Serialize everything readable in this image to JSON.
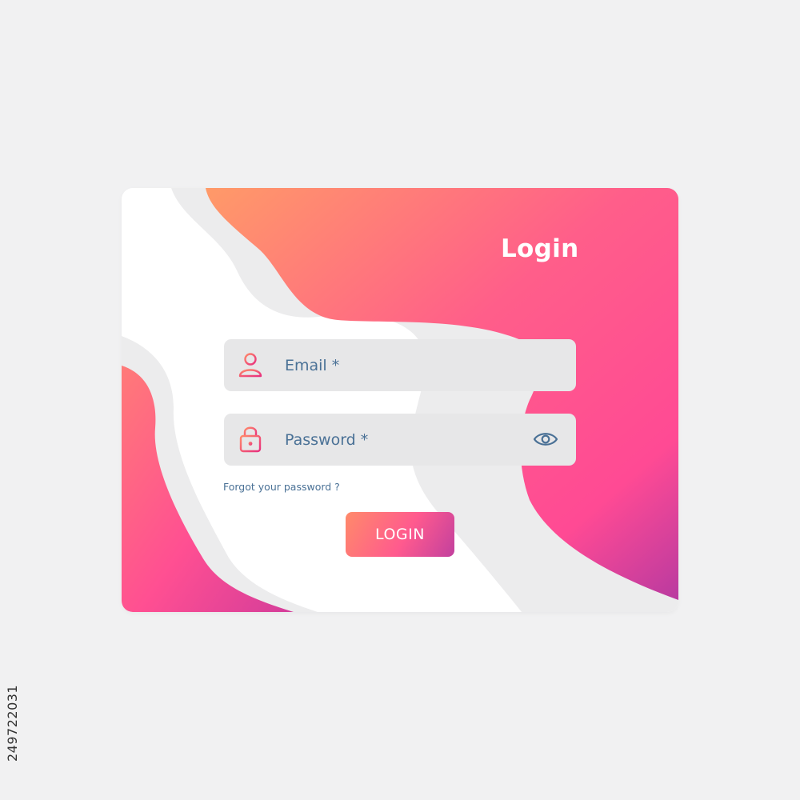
{
  "colors": {
    "page_background": "#f1f1f2",
    "gradient_orange": "#ff9a6a",
    "gradient_pink": "#ff4f95",
    "gradient_purple": "#b73a9e",
    "field_background": "#e7e7e8",
    "text_blue": "#4a7196"
  },
  "login_card": {
    "title": "Login",
    "email_field": {
      "placeholder": "Email *",
      "value": "",
      "icon": "user-icon"
    },
    "password_field": {
      "placeholder": "Password *",
      "value": "",
      "icon": "lock-icon",
      "toggle_icon": "eye-icon"
    },
    "forgot_password_label": "Forgot your password ?",
    "login_button_label": "LOGIN"
  },
  "stock_id": "249722031"
}
